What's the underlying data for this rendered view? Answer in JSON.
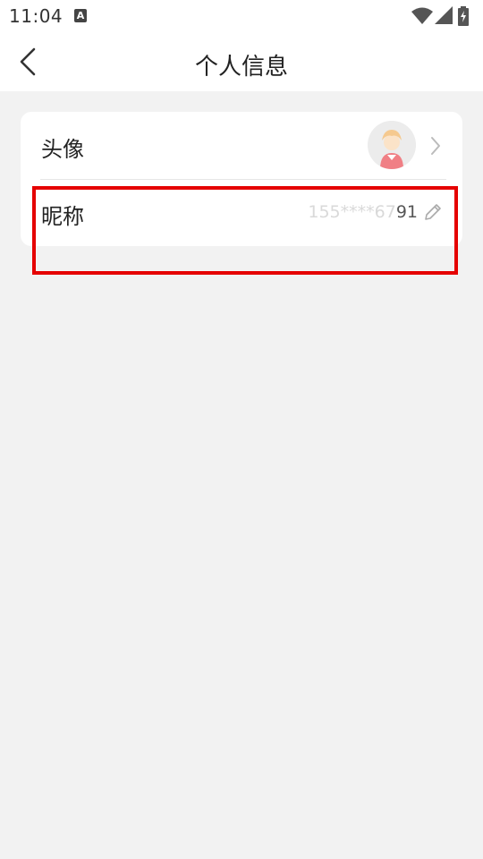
{
  "status_bar": {
    "time": "11:04",
    "notification_letter": "A",
    "icons": [
      "wifi-icon",
      "signal-icon",
      "battery-charging-icon"
    ]
  },
  "header": {
    "title": "个人信息",
    "back_icon": "chevron-left-icon"
  },
  "profile": {
    "avatar_row": {
      "label": "头像",
      "chevron_icon": "chevron-right-icon"
    },
    "nickname_row": {
      "label": "昵称",
      "value_faded": "155****67",
      "value_tail": "91",
      "edit_icon": "pencil-icon"
    }
  },
  "colors": {
    "background": "#f2f2f2",
    "card": "#ffffff",
    "highlight": "#e50000"
  }
}
